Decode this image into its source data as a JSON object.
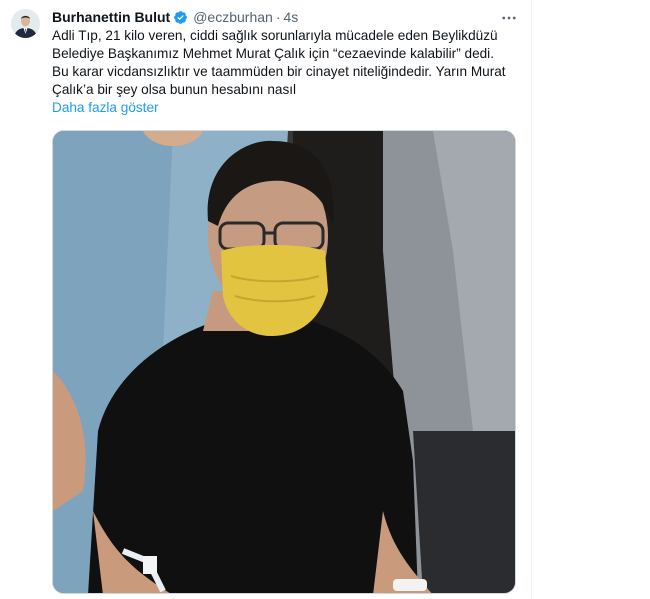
{
  "author": {
    "name": "Burhanettin Bulut",
    "handle": "@eczburhan",
    "separator": "·",
    "time": "4s"
  },
  "tweet": {
    "lines": [
      "Adli Tıp, 21 kilo veren, ciddi sağlık sorunlarıyla mücadele eden Beylikdüzü",
      "Belediye Başkanımız Mehmet Murat Çalık için “cezaevinde kalabilir” dedi.",
      "Bu karar vicdansızlıktır ve taammüden bir cinayet niteliğindedir. Yarın Murat",
      "Çalık’a bir şey olsa bunun hesabını nasıl"
    ],
    "show_more": "Daha fazla göster"
  },
  "icons": {
    "verified": "verified-badge-icon",
    "more": "more-options-icon"
  },
  "colors": {
    "text": "#0f1419",
    "secondary": "#536471",
    "link": "#1d9bf0",
    "verified": "#1d9bf0"
  }
}
